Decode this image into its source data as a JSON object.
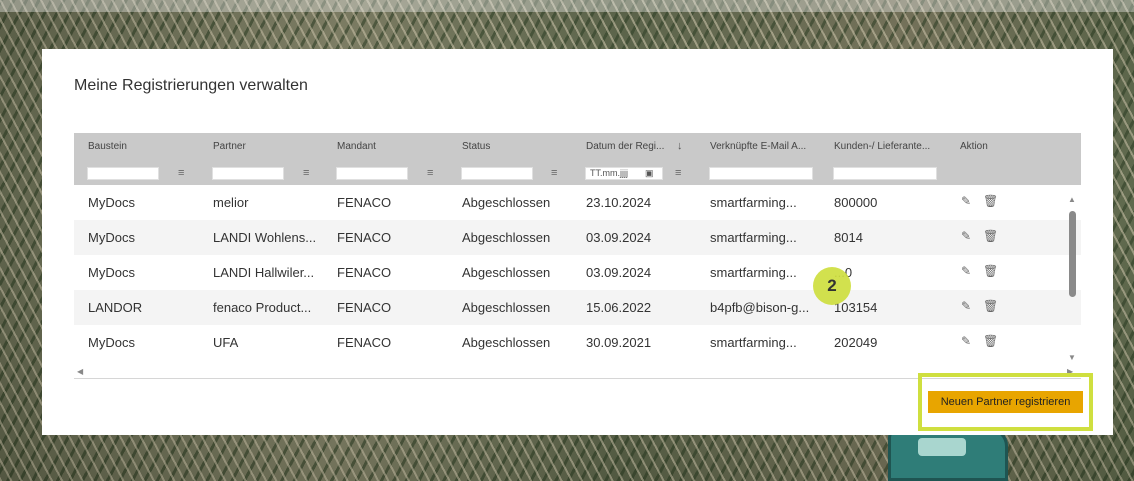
{
  "page": {
    "title": "Meine Registrierungen verwalten",
    "register_button": "Neuen Partner registrieren",
    "step_badge": "2"
  },
  "table": {
    "headers": [
      "Baustein",
      "Partner",
      "Mandant",
      "Status",
      "Datum der Regi...",
      "Verknüpfte E-Mail A...",
      "Kunden-/ Lieferante...",
      "Aktion"
    ],
    "date_placeholder": "TT.mm.jjjj",
    "rows": [
      [
        "MyDocs",
        "melior",
        "FENACO",
        "Abgeschlossen",
        "23.10.2024",
        "smartfarming...",
        "800000"
      ],
      [
        "MyDocs",
        "LANDI Wohlens...",
        "FENACO",
        "Abgeschlossen",
        "03.09.2024",
        "smartfarming...",
        "8014"
      ],
      [
        "MyDocs",
        "LANDI Hallwiler...",
        "FENACO",
        "Abgeschlossen",
        "03.09.2024",
        "smartfarming...",
        "...0"
      ],
      [
        "LANDOR",
        "fenaco Product...",
        "FENACO",
        "Abgeschlossen",
        "15.06.2022",
        "b4pfb@bison-g...",
        "103154"
      ],
      [
        "MyDocs",
        "UFA",
        "FENACO",
        "Abgeschlossen",
        "30.09.2021",
        "smartfarming...",
        "202049"
      ]
    ]
  },
  "icons": {
    "filter": "filter-icon",
    "sort": "sort-down-icon",
    "calendar": "calendar-icon",
    "edit": "pencil-icon",
    "delete": "trash-icon"
  },
  "colors": {
    "header_bg": "#c9c9c9",
    "button_bg": "#e8a500",
    "highlight": "#cfdf3f"
  }
}
